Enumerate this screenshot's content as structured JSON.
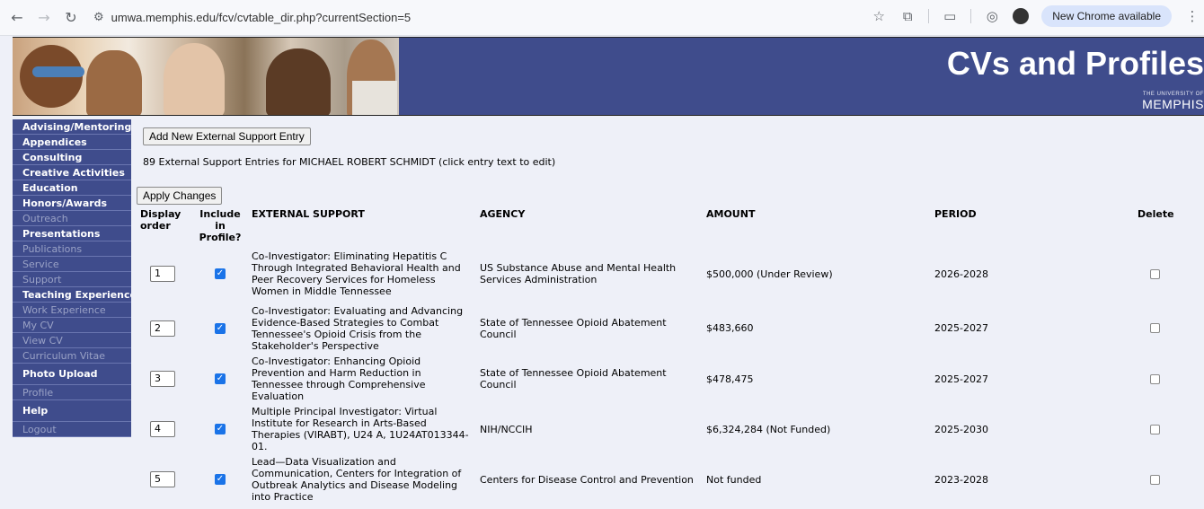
{
  "browser": {
    "url": "umwa.memphis.edu/fcv/cvtable_dir.php?currentSection=5",
    "update_label": "New Chrome available"
  },
  "banner": {
    "title": "CVs and Profiles",
    "university_small": "THE UNIVERSITY OF",
    "university_big": "MEMPHIS"
  },
  "sidebar": {
    "items": [
      {
        "label": "Advising/Mentoring",
        "active": true
      },
      {
        "label": "Appendices",
        "active": true
      },
      {
        "label": "Consulting",
        "active": true
      },
      {
        "label": "Creative Activities",
        "active": true
      },
      {
        "label": "Education",
        "active": true
      },
      {
        "label": "Honors/Awards",
        "active": true
      },
      {
        "label": "Outreach",
        "active": false
      },
      {
        "label": "Presentations",
        "active": true
      },
      {
        "label": "Publications",
        "active": false
      },
      {
        "label": "Service",
        "active": false
      },
      {
        "label": "Support",
        "active": false
      },
      {
        "label": "Teaching Experience",
        "active": true
      },
      {
        "label": "Work Experience",
        "active": false
      },
      {
        "label": "My CV",
        "active": false
      },
      {
        "label": "View CV",
        "active": false
      },
      {
        "label": "Curriculum Vitae",
        "active": false
      },
      {
        "label": "Photo Upload",
        "active": true
      },
      {
        "label": "Profile",
        "active": false
      },
      {
        "label": "Help",
        "active": true
      },
      {
        "label": "Logout",
        "active": false
      }
    ]
  },
  "main": {
    "add_button": "Add New External Support Entry",
    "caption": "89 External Support Entries for MICHAEL ROBERT SCHMIDT (click entry text to edit)",
    "apply_button": "Apply Changes",
    "headers": {
      "order": "Display order",
      "include": "Include in Profile?",
      "support": "EXTERNAL SUPPORT",
      "agency": "AGENCY",
      "amount": "AMOUNT",
      "period": "PERIOD",
      "delete": "Delete"
    },
    "rows": [
      {
        "order": "1",
        "included": true,
        "support": "Co-Investigator: Eliminating Hepatitis C Through Integrated Behavioral Health and Peer Recovery Services for Homeless Women in Middle Tennessee",
        "agency": "US Substance Abuse and Mental Health Services Administration",
        "amount": "$500,000 (Under Review)",
        "period": "2026-2028"
      },
      {
        "order": "2",
        "included": true,
        "support": "Co-Investigator: Evaluating and Advancing Evidence-Based Strategies to Combat Tennessee's Opioid Crisis from the Stakeholder's Perspective",
        "agency": "State of Tennessee Opioid Abatement Council",
        "amount": "$483,660",
        "period": "2025-2027"
      },
      {
        "order": "3",
        "included": true,
        "support": "Co-Investigator: Enhancing Opioid Prevention and Harm Reduction in Tennessee through Comprehensive Evaluation",
        "agency": "State of Tennessee Opioid Abatement Council",
        "amount": "$478,475",
        "period": "2025-2027"
      },
      {
        "order": "4",
        "included": true,
        "support": "Multiple Principal Investigator: Virtual Institute for Research in Arts-Based Therapies (VIRABT), U24 A, 1U24AT013344-01.",
        "agency": "NIH/NCCIH",
        "amount": "$6,324,284 (Not Funded)",
        "period": "2025-2030"
      },
      {
        "order": "5",
        "included": true,
        "support": "Lead—Data Visualization and Communication, Centers for Integration of Outbreak Analytics and Disease Modeling into Practice",
        "agency": "Centers for Disease Control and Prevention",
        "amount": "Not funded",
        "period": "2023-2028"
      }
    ]
  }
}
